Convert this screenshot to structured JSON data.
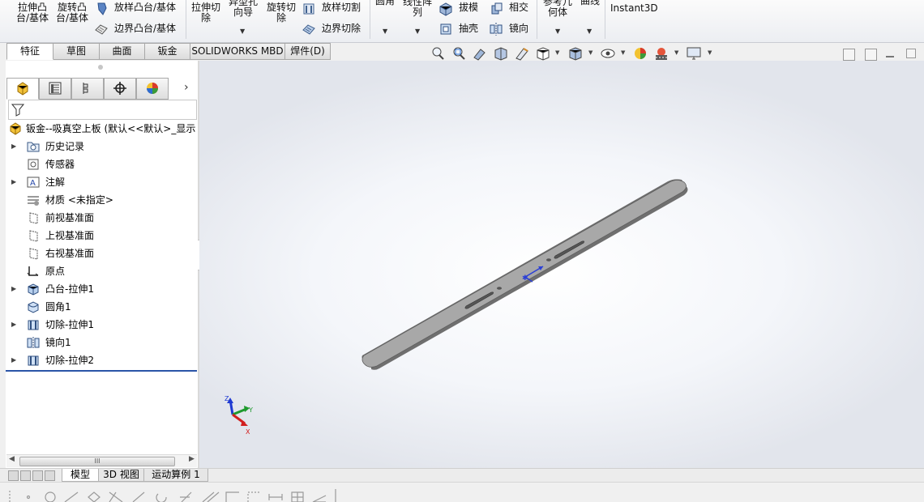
{
  "ribbon": {
    "extrude_boss": "拉伸凸\n台/基体",
    "revolve_boss": "旋转凸\n台/基体",
    "loft_boss": "放样凸台/基体",
    "boundary_boss": "边界凸台/基体",
    "extrude_cut": "拉伸切\n除",
    "hole_wizard": "异型孔\n向导",
    "revolve_cut": "旋转切\n除",
    "loft_cut": "放样切割",
    "boundary_cut": "边界切除",
    "fillet": "圆角",
    "linear_pattern": "线性阵\n列",
    "draft": "拔模",
    "shell": "抽壳",
    "intersect": "相交",
    "mirror": "镜向",
    "ref_geometry": "参考几\n何体",
    "curves": "曲线",
    "instant3d": "Instant3D"
  },
  "command_tabs": [
    "特征",
    "草图",
    "曲面",
    "钣金",
    "SOLIDWORKS MBD",
    "焊件(D)"
  ],
  "active_command_tab": "特征",
  "tree": {
    "root": "钣金--吸真空上板 (默认<<默认>_显示",
    "items": [
      {
        "label": "历史记录",
        "icon": "history-folder-icon",
        "expand": true
      },
      {
        "label": "传感器",
        "icon": "sensor-icon",
        "expand": false
      },
      {
        "label": "注解",
        "icon": "annotation-icon",
        "expand": true
      },
      {
        "label": "材质 <未指定>",
        "icon": "material-icon",
        "expand": false
      },
      {
        "label": "前视基准面",
        "icon": "plane-icon",
        "expand": false
      },
      {
        "label": "上视基准面",
        "icon": "plane-icon",
        "expand": false
      },
      {
        "label": "右视基准面",
        "icon": "plane-icon",
        "expand": false
      },
      {
        "label": "原点",
        "icon": "origin-icon",
        "expand": false
      },
      {
        "label": "凸台-拉伸1",
        "icon": "extrude-feature-icon",
        "expand": true
      },
      {
        "label": "圆角1",
        "icon": "fillet-feature-icon",
        "expand": false
      },
      {
        "label": "切除-拉伸1",
        "icon": "cut-extrude-feature-icon",
        "expand": true
      },
      {
        "label": "镜向1",
        "icon": "mirror-feature-icon",
        "expand": false
      },
      {
        "label": "切除-拉伸2",
        "icon": "cut-extrude-feature-icon",
        "expand": true
      }
    ]
  },
  "model_tabs": [
    "模型",
    "3D 视图",
    "运动算例 1"
  ],
  "active_model_tab": "模型",
  "colors": {
    "accent_blue": "#2b55a7",
    "part_gray": "#8c8c8c",
    "axis_x": "#d21f1f",
    "axis_y": "#1f9a2e",
    "axis_z": "#1f3ad2"
  }
}
